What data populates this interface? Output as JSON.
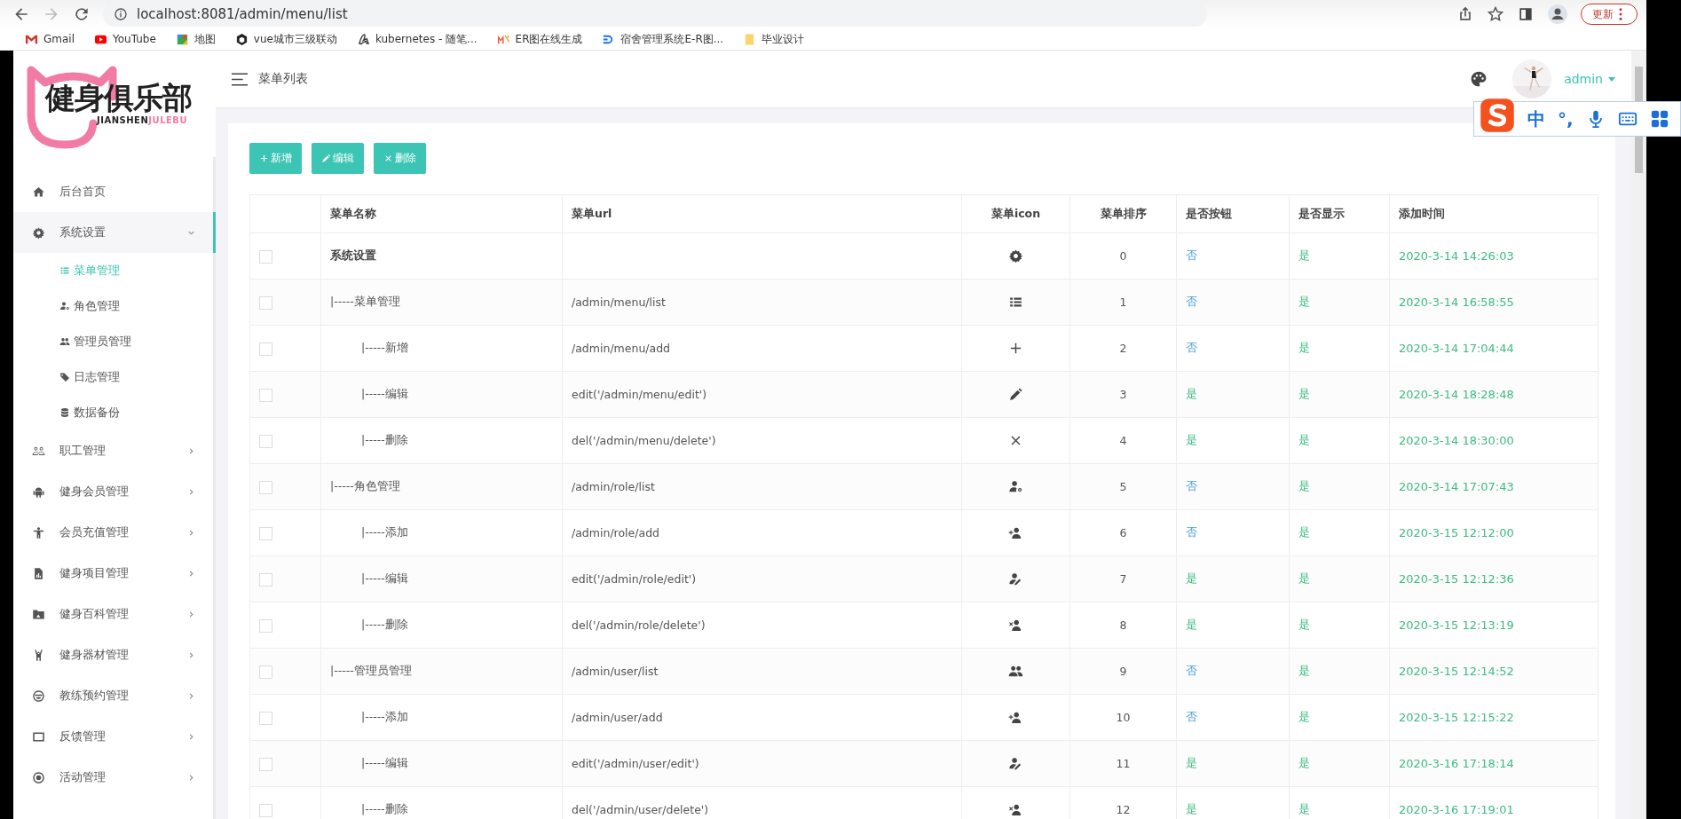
{
  "browser": {
    "url": "localhost:8081/admin/menu/list",
    "update_button": "更新",
    "bookmarks": [
      {
        "label": "Gmail",
        "kind": "gmail"
      },
      {
        "label": "YouTube",
        "kind": "youtube"
      },
      {
        "label": "地图",
        "kind": "maps"
      },
      {
        "label": "vue城市三级联动",
        "kind": "cube"
      },
      {
        "label": "kubernetes - 随笔...",
        "kind": "glyph"
      },
      {
        "label": "ER图在线生成",
        "kind": "mx"
      },
      {
        "label": "宿舍管理系统E-R图...",
        "kind": "dlogo"
      },
      {
        "label": "毕业设计",
        "kind": "folder"
      }
    ]
  },
  "logo": {
    "title": "健身俱乐部",
    "subtitle_left": "JIANSHEN",
    "subtitle_right": "JULEBU"
  },
  "sidebar": {
    "items": [
      {
        "label": "后台首页",
        "kind": "home"
      },
      {
        "label": "系统设置",
        "kind": "gear",
        "expanded": true,
        "children": [
          {
            "label": "菜单管理",
            "kind": "list",
            "selected": true
          },
          {
            "label": "角色管理",
            "kind": "usergear",
            "selected": false
          },
          {
            "label": "管理员管理",
            "kind": "users",
            "selected": false
          },
          {
            "label": "日志管理",
            "kind": "tag",
            "selected": false
          },
          {
            "label": "数据备份",
            "kind": "database",
            "selected": false
          }
        ]
      },
      {
        "label": "职工管理",
        "kind": "people",
        "expanded": false
      },
      {
        "label": "健身会员管理",
        "kind": "android",
        "expanded": false
      },
      {
        "label": "会员充值管理",
        "kind": "person",
        "expanded": false
      },
      {
        "label": "健身项目管理",
        "kind": "filechart",
        "expanded": false
      },
      {
        "label": "健身百科管理",
        "kind": "folderimg",
        "expanded": false
      },
      {
        "label": "健身器材管理",
        "kind": "figure",
        "expanded": false
      },
      {
        "label": "教练预约管理",
        "kind": "smile",
        "expanded": false
      },
      {
        "label": "反馈管理",
        "kind": "window",
        "expanded": false
      },
      {
        "label": "活动管理",
        "kind": "target",
        "expanded": false
      }
    ]
  },
  "header": {
    "title": "菜单列表",
    "user": "admin"
  },
  "ime_toolbar": {
    "mode": "中",
    "punctuation": "°,"
  },
  "toolbar": {
    "buttons": [
      {
        "label": "新增",
        "kind": "add"
      },
      {
        "label": "编辑",
        "kind": "edit"
      },
      {
        "label": "删除",
        "kind": "delete"
      }
    ]
  },
  "table": {
    "columns": [
      "菜单名称",
      "菜单url",
      "菜单icon",
      "菜单排序",
      "是否按钮",
      "是否显示",
      "添加时间"
    ],
    "rows": [
      {
        "name": "系统设置",
        "kind": "gear",
        "sort": "0",
        "is_button": {
          "label": "否",
          "on": false
        },
        "is_shown": {
          "label": "是",
          "on": true
        },
        "added": "2020-3-14 14:26:03",
        "checked": false,
        "children": [
          {
            "name": "|-----菜单管理",
            "url": "/admin/menu/list",
            "kind": "list",
            "sort": "1",
            "is_button": {
              "label": "否",
              "on": false
            },
            "is_shown": {
              "label": "是",
              "on": true
            },
            "added": "2020-3-14 16:58:55",
            "checked": false,
            "children": [
              {
                "name": "|-----新增",
                "url": "/admin/menu/add",
                "kind": "plus",
                "sort": "2",
                "is_button": {
                  "label": "否",
                  "on": false
                },
                "is_shown": {
                  "label": "是",
                  "on": true
                },
                "added": "2020-3-14 17:04:44",
                "checked": false
              },
              {
                "name": "|-----编辑",
                "url": "edit('/admin/menu/edit')",
                "kind": "pencil",
                "sort": "3",
                "is_button": {
                  "label": "是",
                  "on": true
                },
                "is_shown": {
                  "label": "是",
                  "on": true
                },
                "added": "2020-3-14 18:28:48",
                "checked": false
              },
              {
                "name": "|-----删除",
                "url": "del('/admin/menu/delete')",
                "kind": "cross",
                "sort": "4",
                "is_button": {
                  "label": "是",
                  "on": true
                },
                "is_shown": {
                  "label": "是",
                  "on": true
                },
                "added": "2020-3-14 18:30:00",
                "checked": false
              }
            ]
          },
          {
            "name": "|-----角色管理",
            "url": "/admin/role/list",
            "kind": "usergear",
            "sort": "5",
            "is_button": {
              "label": "否",
              "on": false
            },
            "is_shown": {
              "label": "是",
              "on": true
            },
            "added": "2020-3-14 17:07:43",
            "checked": false,
            "children": [
              {
                "name": "|-----添加",
                "url": "/admin/role/add",
                "kind": "useradd",
                "sort": "6",
                "is_button": {
                  "label": "否",
                  "on": false
                },
                "is_shown": {
                  "label": "是",
                  "on": true
                },
                "added": "2020-3-15 12:12:00",
                "checked": false
              },
              {
                "name": "|-----编辑",
                "url": "edit('/admin/role/edit')",
                "kind": "useredit",
                "sort": "7",
                "is_button": {
                  "label": "是",
                  "on": true
                },
                "is_shown": {
                  "label": "是",
                  "on": true
                },
                "added": "2020-3-15 12:12:36",
                "checked": false
              },
              {
                "name": "|-----删除",
                "url": "del('/admin/role/delete')",
                "kind": "userremove",
                "sort": "8",
                "is_button": {
                  "label": "是",
                  "on": true
                },
                "is_shown": {
                  "label": "是",
                  "on": true
                },
                "added": "2020-3-15 12:13:19",
                "checked": false
              }
            ]
          },
          {
            "name": "|-----管理员管理",
            "url": "/admin/user/list",
            "kind": "users",
            "sort": "9",
            "is_button": {
              "label": "否",
              "on": false
            },
            "is_shown": {
              "label": "是",
              "on": true
            },
            "added": "2020-3-15 12:14:52",
            "checked": false,
            "children": [
              {
                "name": "|-----添加",
                "url": "/admin/user/add",
                "kind": "useradd",
                "sort": "10",
                "is_button": {
                  "label": "否",
                  "on": false
                },
                "is_shown": {
                  "label": "是",
                  "on": true
                },
                "added": "2020-3-15 12:15:22",
                "checked": false
              },
              {
                "name": "|-----编辑",
                "url": "edit('/admin/user/edit')",
                "kind": "useredit",
                "sort": "11",
                "is_button": {
                  "label": "是",
                  "on": true
                },
                "is_shown": {
                  "label": "是",
                  "on": true
                },
                "added": "2020-3-16 17:18:14",
                "checked": false
              },
              {
                "name": "|-----删除",
                "url": "del('/admin/user/delete')",
                "kind": "userremove",
                "sort": "12",
                "is_button": {
                  "label": "是",
                  "on": true
                },
                "is_shown": {
                  "label": "是",
                  "on": true
                },
                "added": "2020-3-16 17:19:01",
                "checked": false
              }
            ]
          }
        ]
      }
    ]
  }
}
